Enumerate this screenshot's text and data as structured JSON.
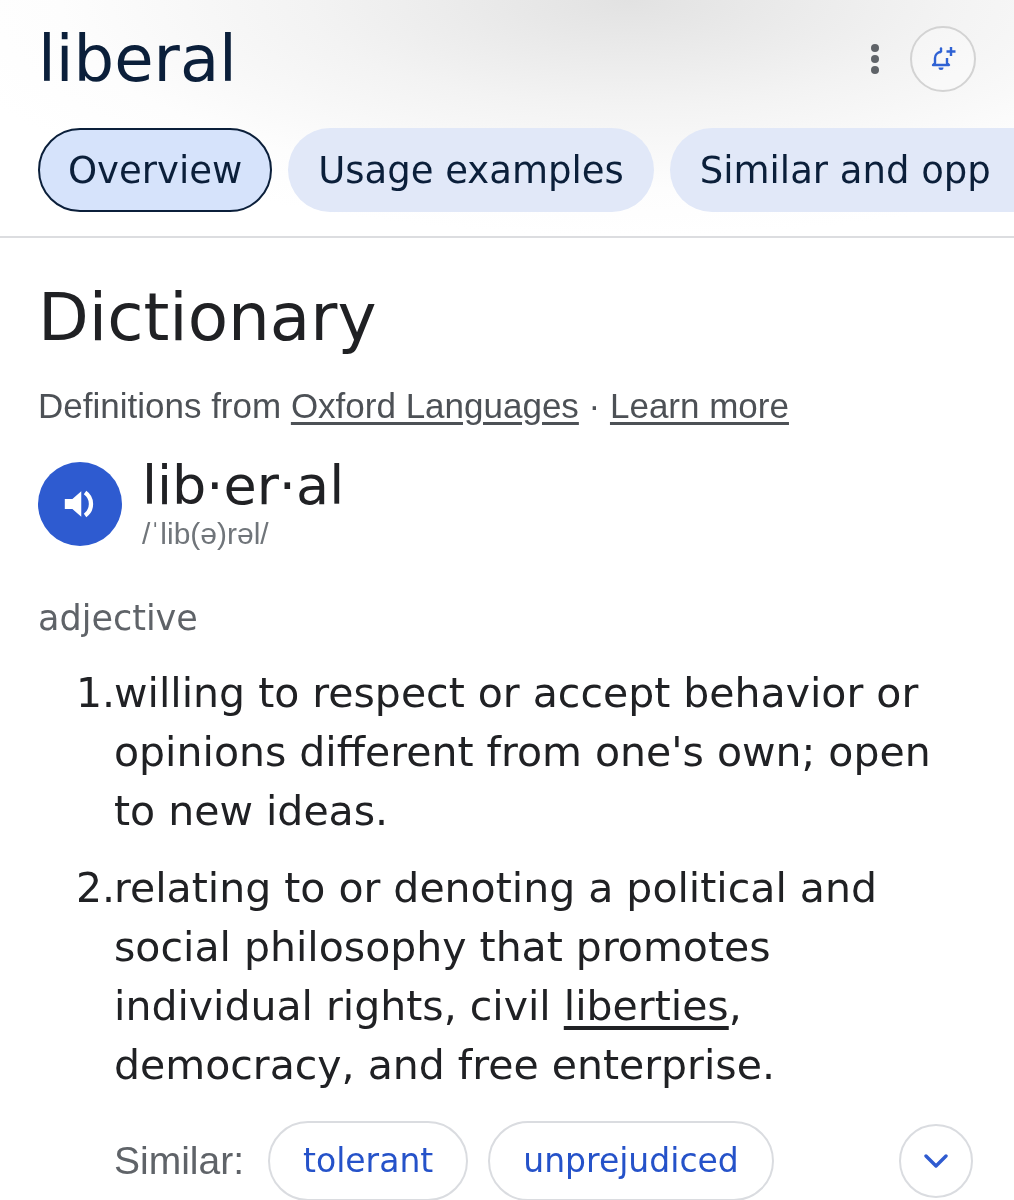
{
  "header": {
    "title": "liberal"
  },
  "tabs": [
    {
      "label": "Overview",
      "selected": true
    },
    {
      "label": "Usage examples",
      "selected": false
    },
    {
      "label": "Similar and opp",
      "selected": false
    }
  ],
  "dictionary": {
    "heading": "Dictionary",
    "source": [
      {
        "kind": "text",
        "text": "Definitions from "
      },
      {
        "kind": "link",
        "text": "Oxford Languages"
      },
      {
        "kind": "text",
        "text": " · "
      },
      {
        "kind": "link",
        "text": "Learn more"
      }
    ],
    "entry": {
      "word": "lib·er·al",
      "pronunciation": "/ˈlib(ə)rəl/"
    },
    "part_of_speech": "adjective",
    "definitions": [
      {
        "number": "1.",
        "segments": [
          {
            "kind": "text",
            "text": "willing to respect or accept behavior or opinions different from one's own; open to new ideas."
          }
        ]
      },
      {
        "number": "2.",
        "segments": [
          {
            "kind": "text",
            "text": "relating to or denoting a political and social philosophy that promotes individual rights, civil "
          },
          {
            "kind": "link",
            "text": "liberties"
          },
          {
            "kind": "text",
            "text": ", democracy, and free enterprise."
          }
        ]
      }
    ],
    "similar": {
      "label": "Similar:",
      "words": [
        "tolerant",
        "unprejudiced"
      ]
    }
  }
}
